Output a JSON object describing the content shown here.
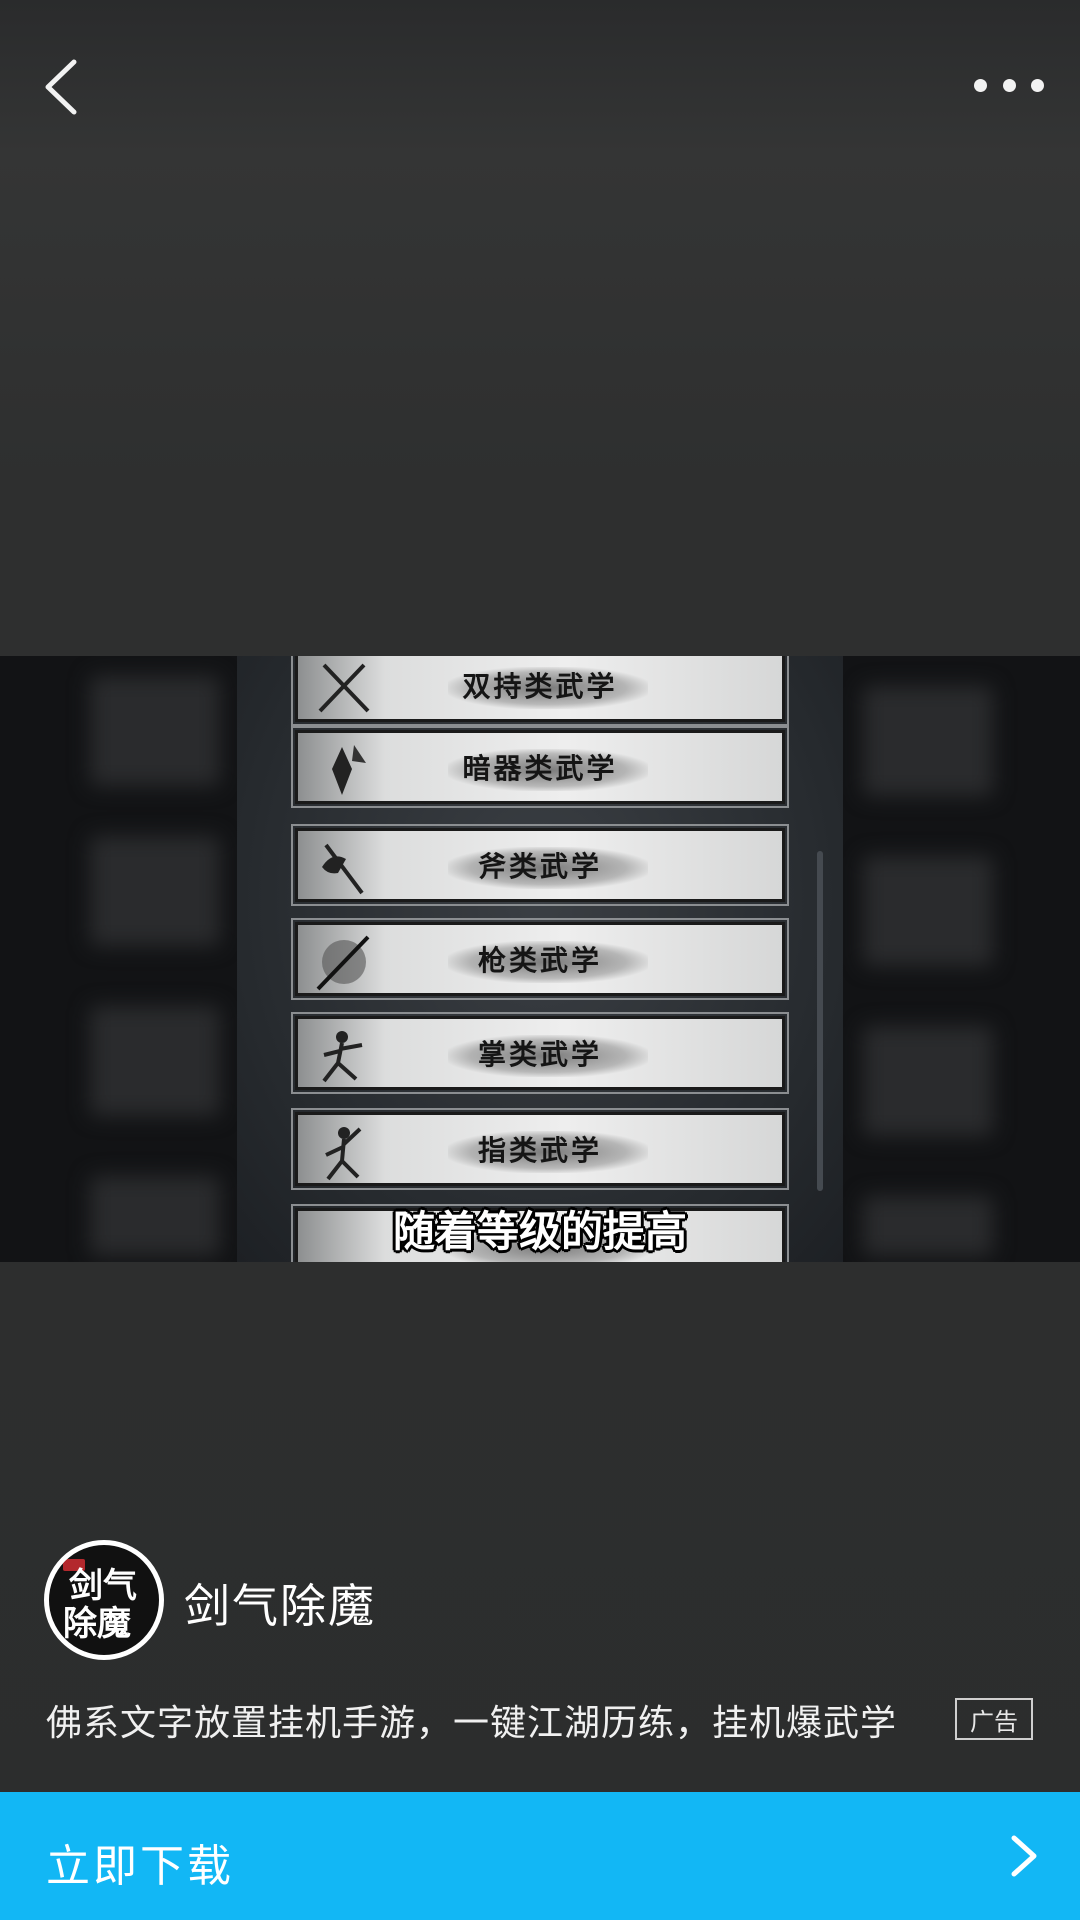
{
  "header": {
    "back_icon": "chevron-left-icon",
    "more_icon": "more-horizontal-icon"
  },
  "video": {
    "skills": [
      {
        "label": "双持类武学",
        "icon": "crossed-swords-icon"
      },
      {
        "label": "暗器类武学",
        "icon": "hidden-weapon-icon"
      },
      {
        "label": "斧类武学",
        "icon": "axe-icon"
      },
      {
        "label": "枪类武学",
        "icon": "spear-icon"
      },
      {
        "label": "掌类武学",
        "icon": "palm-fighter-icon"
      },
      {
        "label": "指类武学",
        "icon": "finger-fighter-icon"
      }
    ],
    "subtitle": "随着等级的提高"
  },
  "app": {
    "avatar_text_top": "剑气",
    "avatar_text_bottom": "除魔",
    "name": "剑气除魔",
    "description": "佛系文字放置挂机手游，一键江湖历练，挂机爆武学",
    "ad_badge": "广告"
  },
  "cta": {
    "label": "立即下载",
    "icon": "chevron-right-icon",
    "color": "#12b7f5"
  }
}
